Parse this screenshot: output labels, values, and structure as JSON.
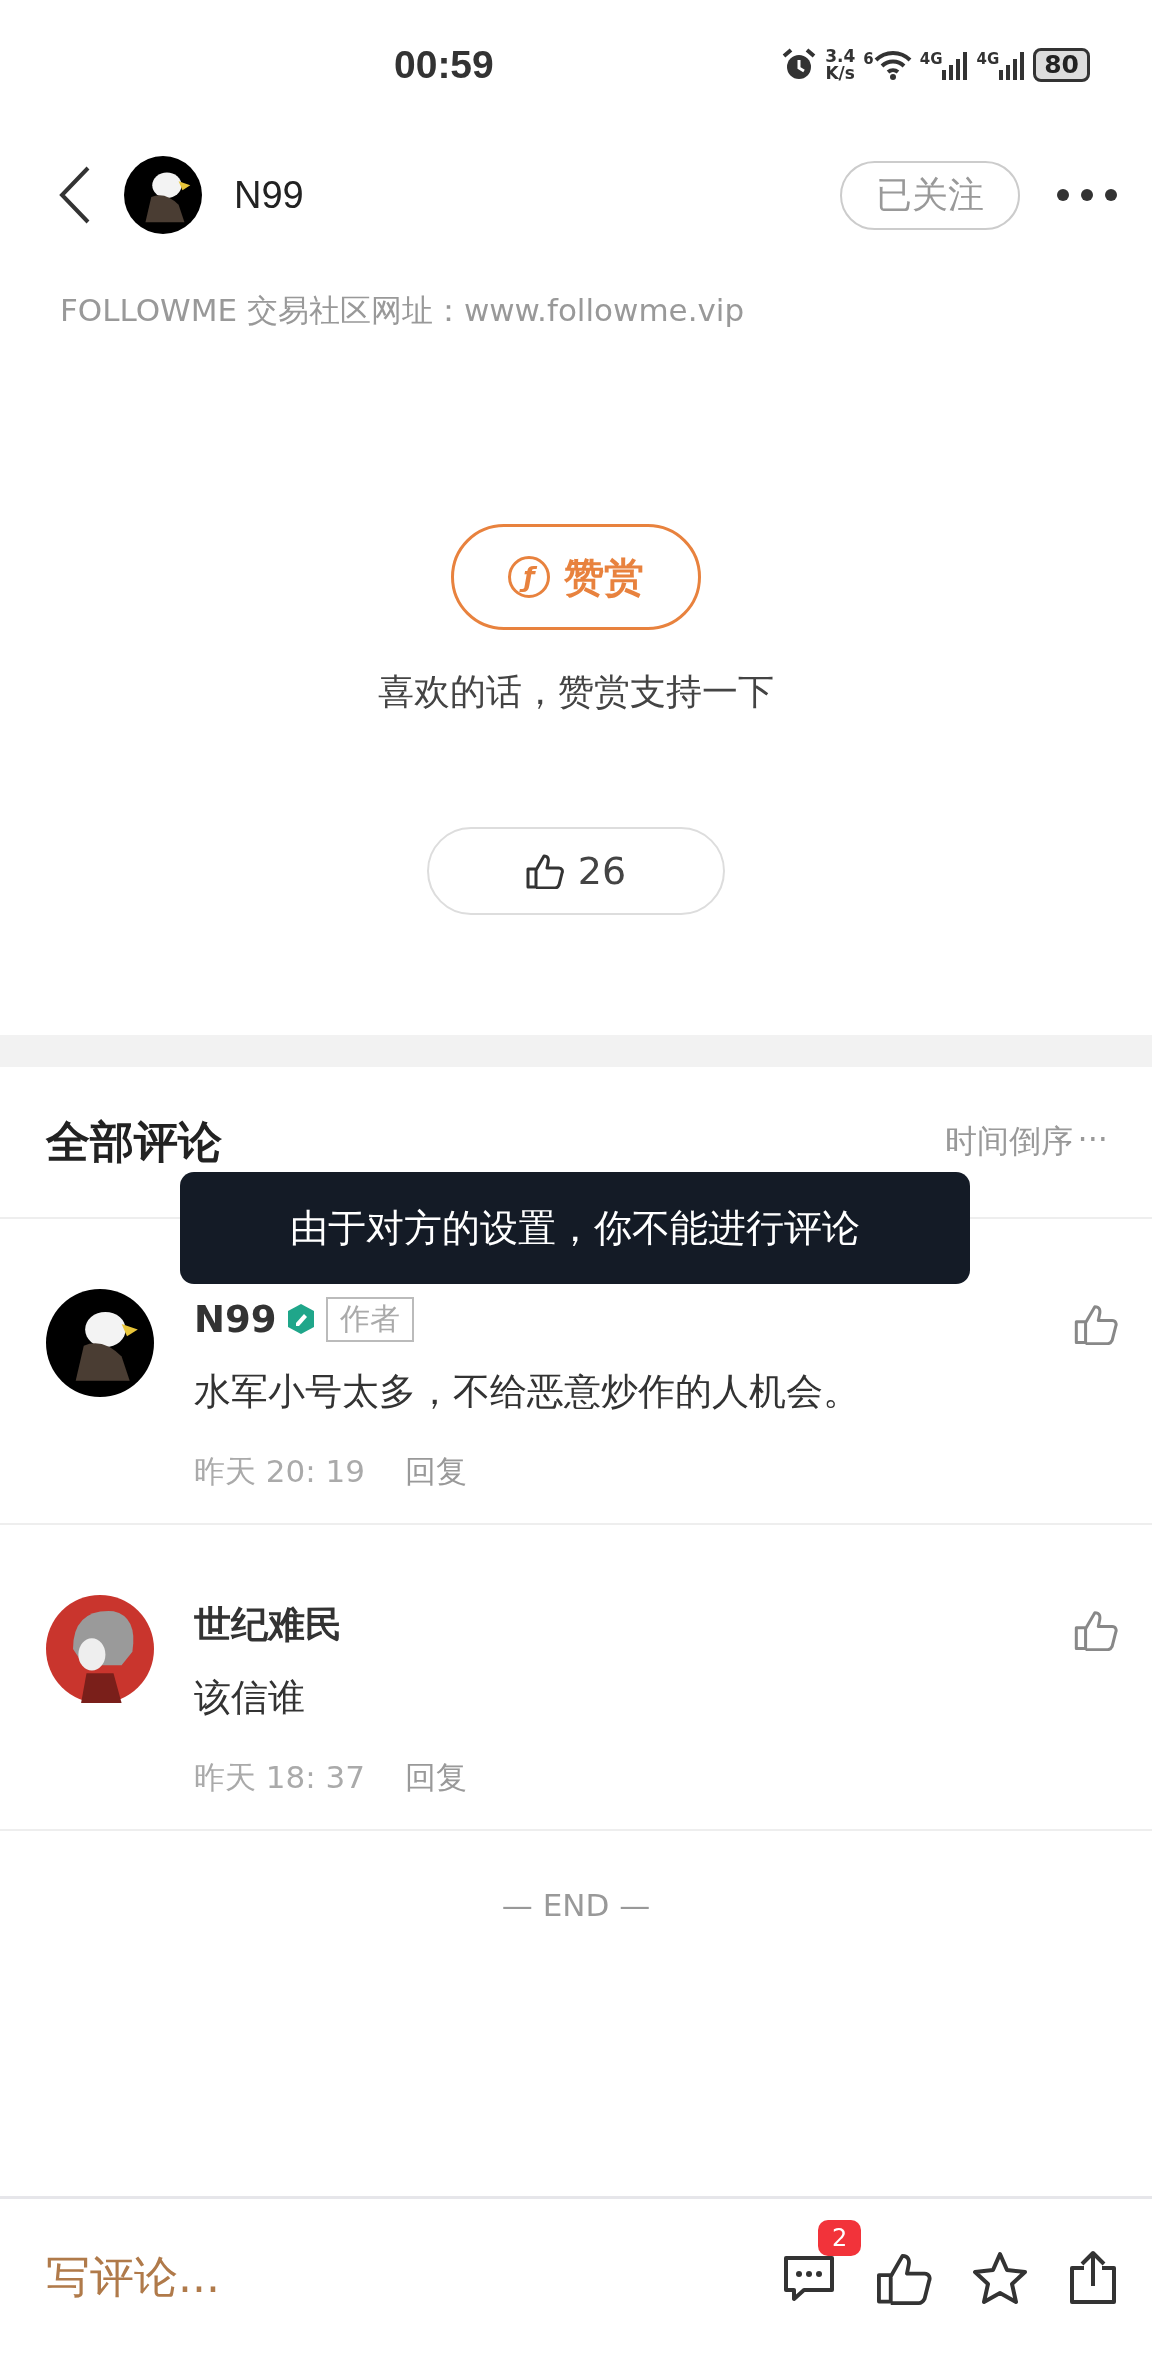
{
  "status_bar": {
    "time": "00:59",
    "net_speed": [
      "3.4",
      "K/s"
    ],
    "wifi_label": "6",
    "signals": [
      "4G",
      "4G"
    ],
    "battery": "80"
  },
  "header": {
    "author": "N99",
    "follow_button": "已关注"
  },
  "site_note": "FOLLOWME 交易社区网址：www.followme.vip",
  "tip": {
    "icon": "ƒ",
    "button": "赞赏",
    "caption": "喜欢的话，赞赏支持一下"
  },
  "like": {
    "count": "26"
  },
  "comments_section": {
    "title": "全部评论",
    "sort": "时间倒序",
    "sort_more": "···",
    "comments": [
      {
        "name": "N99",
        "verified": true,
        "badge": "作者",
        "text": "水军小号太多，不给恶意炒作的人机会。",
        "time": "昨天 20: 19",
        "reply": "回复"
      },
      {
        "name": "世纪难民",
        "verified": false,
        "text": "该信谁",
        "time": "昨天 18: 37",
        "reply": "回复"
      }
    ],
    "end_mark": "— END —"
  },
  "toast": "由于对方的设置，你不能进行评论",
  "bottom_bar": {
    "write_placeholder": "写评论...",
    "comment_count": "2"
  }
}
